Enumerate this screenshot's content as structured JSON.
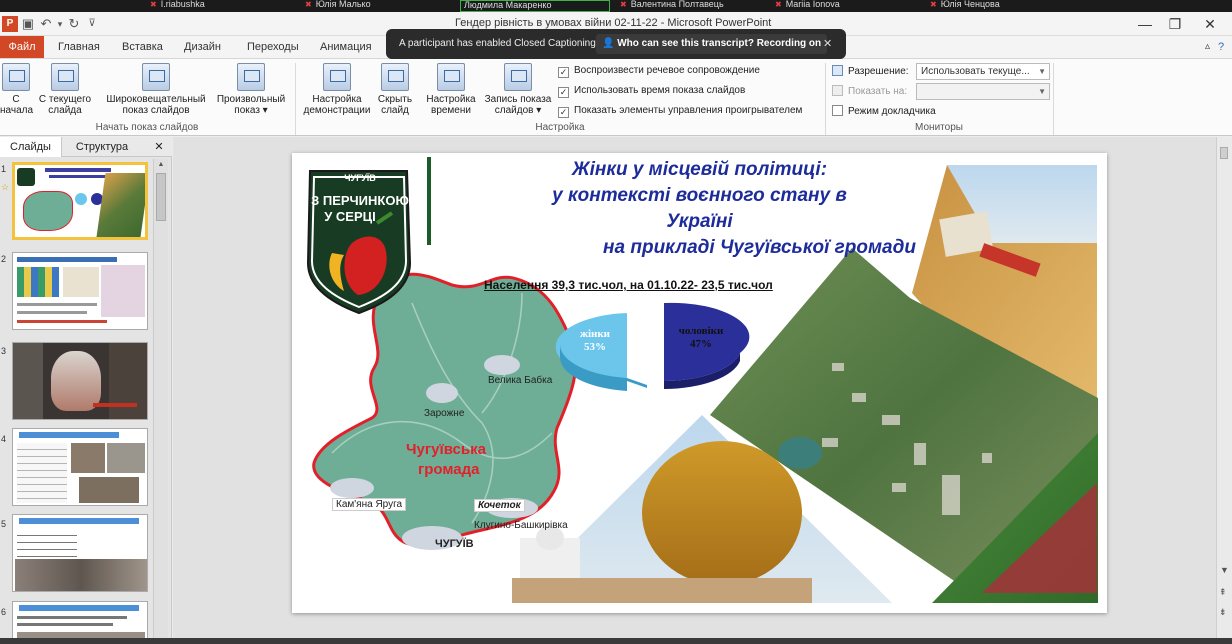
{
  "participants": [
    {
      "name": "I.riabushka"
    },
    {
      "name": "Юлія Малько"
    },
    {
      "name": "Людмила Макаренко"
    },
    {
      "name": "Валентина Полтавець"
    },
    {
      "name": "Mariia Ionova"
    },
    {
      "name": "Юлія Ченцова"
    }
  ],
  "window": {
    "title": "Гендер рівність в умовах війни 02-11-22 - Microsoft PowerPoint",
    "minimize": "—",
    "restore": "❐",
    "close": "✕"
  },
  "tabs": {
    "file": "Файл",
    "items": [
      "Главная",
      "Вставка",
      "Дизайн",
      "Переходы",
      "Анимация"
    ]
  },
  "toast": {
    "message": "A participant has enabled Closed Captioning",
    "link": "Who can see this transcript? Recording on",
    "close": "✕"
  },
  "ribbon": {
    "start_group": {
      "label": "Начать показ слайдов",
      "buttons": [
        {
          "line1": "С",
          "line2": "начала"
        },
        {
          "line1": "С текущего",
          "line2": "слайда"
        },
        {
          "line1": "Широковещательный",
          "line2": "показ слайдов"
        },
        {
          "line1": "Произвольный",
          "line2": "показ ▾"
        }
      ]
    },
    "setup_group": {
      "label": "Настройка",
      "buttons": [
        {
          "line1": "Настройка",
          "line2": "демонстрации"
        },
        {
          "line1": "Скрыть",
          "line2": "слайд"
        },
        {
          "line1": "Настройка",
          "line2": "времени"
        },
        {
          "line1": "Запись показа",
          "line2": "слайдов ▾"
        }
      ],
      "checks": [
        {
          "label": "Воспроизвести речевое сопровождение",
          "checked": "✓"
        },
        {
          "label": "Использовать время показа слайдов",
          "checked": "✓"
        },
        {
          "label": "Показать элементы управления проигрывателем",
          "checked": "✓"
        }
      ]
    },
    "monitors_group": {
      "label": "Мониторы",
      "resolution_label": "Разрешение:",
      "resolution_value": "Использовать текуще...",
      "show_on_label": "Показать на:",
      "presenter_mode": "Режим докладчика"
    }
  },
  "panel": {
    "tab_slides": "Слайды",
    "tab_outline": "Структура",
    "close": "✕",
    "slide_numbers": [
      "1",
      "2",
      "3",
      "4",
      "5",
      "6"
    ]
  },
  "slide": {
    "title_lines": [
      "Жінки у місцевій політиці:",
      "у контексті воєнного стану в",
      "Україні",
      "на прикладі Чугуївської громади"
    ],
    "population": "Населення 39,3 тис.чол, на 01.10.22- 23,5 тис.чол",
    "logo_top": "ЧУГУЇВ",
    "logo_line1": "З ПЕРЧИНКОЮ",
    "logo_line2": "У СЕРЦІ",
    "pie_women_label": "жінки",
    "pie_women_value": "53%",
    "pie_men_label": "чоловіки",
    "pie_men_value": "47%",
    "map_labels": {
      "velyka_babka": "Велика Бабка",
      "zarozhne": "Зарожне",
      "hromada_1": "Чугуївська",
      "hromada_2": "громада",
      "kamyana": "Кам'яна Яруга",
      "kochetok": "Кочеток",
      "klugino": "Клугино-Башкирівка",
      "chuhuiv": "ЧУГУЇВ"
    }
  },
  "colors": {
    "file_tab": "#d24726",
    "title_blue": "#1d2c9a",
    "map_green": "#6fae96",
    "map_border": "#e2202a",
    "pie_women": "#6cc6ec",
    "pie_men": "#2b2f9a"
  }
}
